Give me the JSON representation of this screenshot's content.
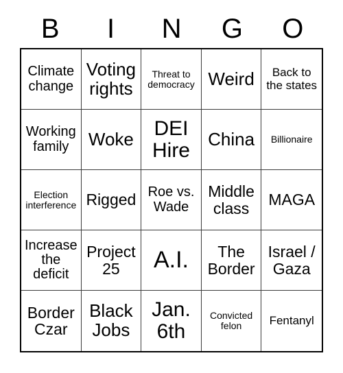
{
  "card": {
    "header_letters": [
      "B",
      "I",
      "N",
      "G",
      "O"
    ],
    "rows": [
      [
        {
          "text": "Climate change",
          "size": "fs-sm"
        },
        {
          "text": "Voting rights",
          "size": "fs-lg"
        },
        {
          "text": "Threat to democracy",
          "size": "fs-xxs"
        },
        {
          "text": "Weird",
          "size": "fs-lg"
        },
        {
          "text": "Back to the states",
          "size": "fs-xs"
        }
      ],
      [
        {
          "text": "Working family",
          "size": "fs-sm"
        },
        {
          "text": "Woke",
          "size": "fs-lg"
        },
        {
          "text": "DEI Hire",
          "size": "fs-xl"
        },
        {
          "text": "China",
          "size": "fs-lg"
        },
        {
          "text": "Billionaire",
          "size": "fs-xxs"
        }
      ],
      [
        {
          "text": "Election interference",
          "size": "fs-xxs"
        },
        {
          "text": "Rigged",
          "size": "fs-md"
        },
        {
          "text": "Roe vs. Wade",
          "size": "fs-sm"
        },
        {
          "text": "Middle class",
          "size": "fs-md"
        },
        {
          "text": "MAGA",
          "size": "fs-md"
        }
      ],
      [
        {
          "text": "Increase the deficit",
          "size": "fs-sm"
        },
        {
          "text": "Project 25",
          "size": "fs-md"
        },
        {
          "text": "A.I.",
          "size": "fs-xxl"
        },
        {
          "text": "The Border",
          "size": "fs-md"
        },
        {
          "text": "Israel / Gaza",
          "size": "fs-md"
        }
      ],
      [
        {
          "text": "Border Czar",
          "size": "fs-md"
        },
        {
          "text": "Black Jobs",
          "size": "fs-lg"
        },
        {
          "text": "Jan. 6th",
          "size": "fs-xl"
        },
        {
          "text": "Convicted felon",
          "size": "fs-xxs"
        },
        {
          "text": "Fentanyl",
          "size": "fs-xs"
        }
      ]
    ]
  },
  "colors": {
    "background": "#ffffff",
    "text": "#000000",
    "outer_border": "#000000",
    "inner_border": "#3a3a3a"
  }
}
